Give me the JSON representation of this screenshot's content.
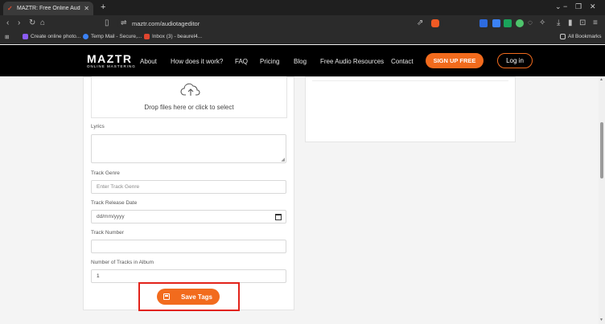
{
  "browser": {
    "tab_title": "MAZTR: Free Online Audio Tag E",
    "url": "maztr.com/audiotageditor",
    "bookmarks": [
      {
        "label": "Create online photo..."
      },
      {
        "label": "Temp Mail - Secure,..."
      },
      {
        "label": "Inbox (3) - beaurel4..."
      }
    ],
    "all_bookmarks": "All Bookmarks"
  },
  "header": {
    "logo_main": "MAZTR",
    "logo_sub": "ONLINE MASTERING",
    "nav": [
      "About",
      "How does it work?",
      "FAQ",
      "Pricing",
      "Blog",
      "Free Audio Resources",
      "Contact"
    ],
    "signup": "SIGN UP FREE",
    "login": "Log in"
  },
  "form": {
    "drop_text": "Drop files here or click to select",
    "lyrics_label": "Lyrics",
    "genre_label": "Track Genre",
    "genre_placeholder": "Enter Track Genre",
    "release_label": "Track Release Date",
    "release_placeholder": "dd/mm/yyyy",
    "number_label": "Track Number",
    "tracks_label": "Number of Tracks in Album",
    "tracks_value": "1",
    "save_label": "Save Tags"
  },
  "colors": {
    "accent": "#f26b1d",
    "highlight": "#e2231a"
  }
}
